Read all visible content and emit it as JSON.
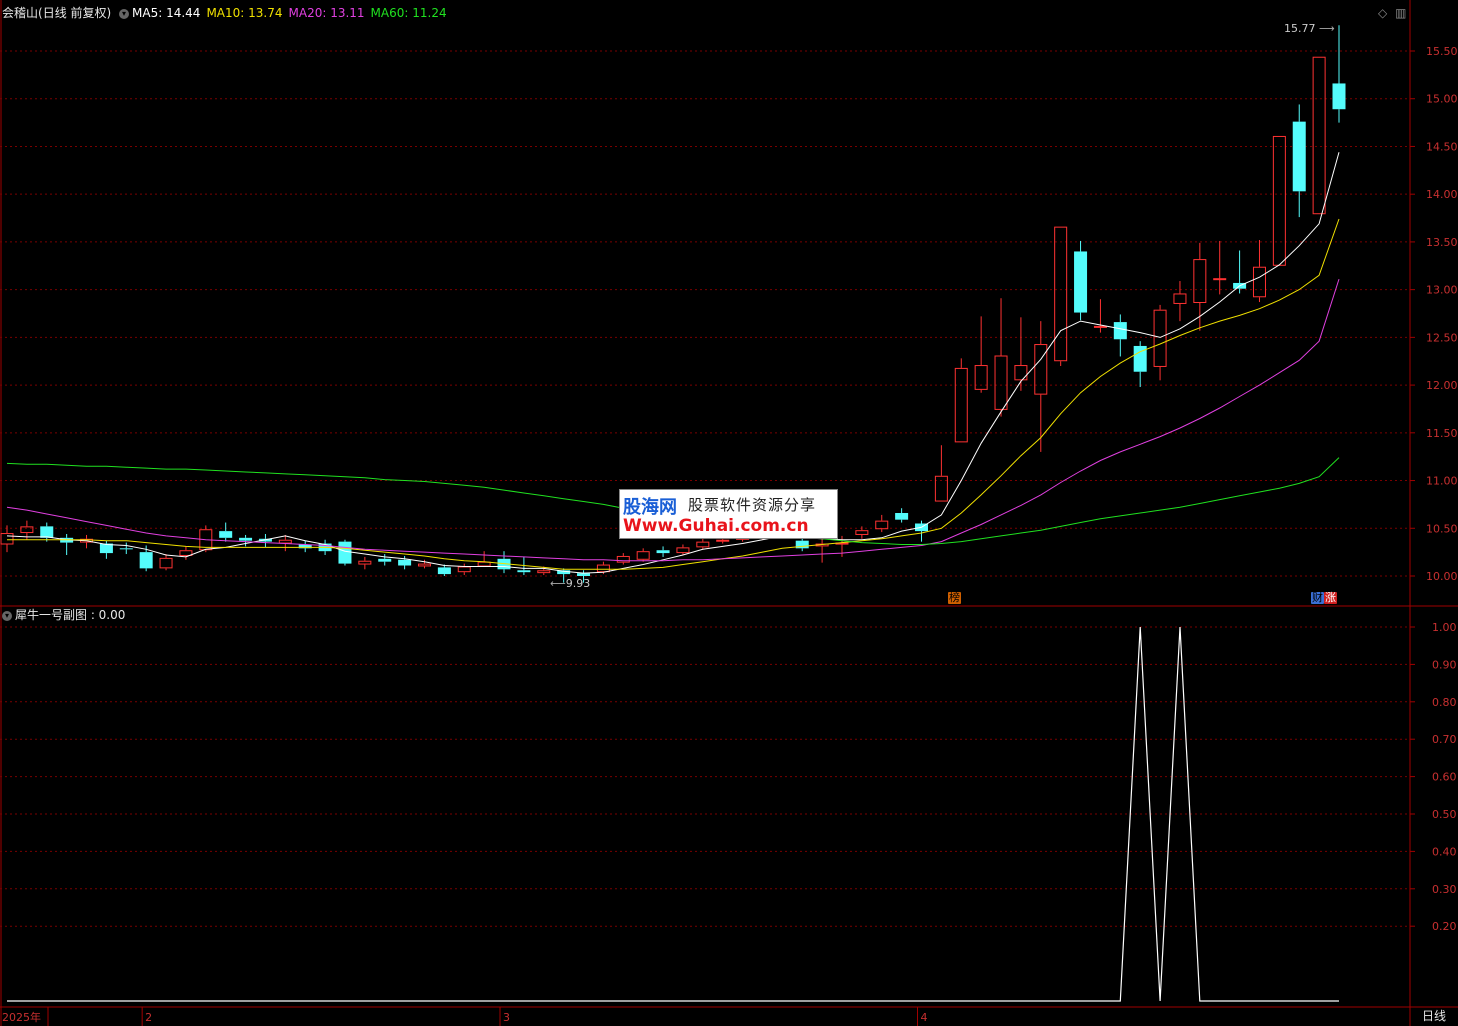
{
  "header": {
    "stock_name": "会稽山",
    "period_info": "(日线 前复权)",
    "ma_labels": [
      {
        "text": "MA5: 14.44",
        "color": "#ffffff"
      },
      {
        "text": "MA10: 13.74",
        "color": "#f0e000"
      },
      {
        "text": "MA20: 13.11",
        "color": "#e040e0"
      },
      {
        "text": "MA60: 11.24",
        "color": "#20e020"
      }
    ]
  },
  "sub_panel": {
    "title": "犀牛一号副图 : 0.00"
  },
  "annotations": {
    "high_label": "15.77",
    "low_label": "9.93",
    "tag1": "榜",
    "tag2": "财",
    "tag3": "涨"
  },
  "bottom_bar": {
    "period_button": "日线"
  },
  "watermark": {
    "logo": "股海网",
    "slogan": "股票软件资源分享",
    "url": "Www.Guhai.com.cn"
  },
  "colors": {
    "up": "#ff3232",
    "down": "#54fcfc",
    "grid": "#7a0000",
    "frame": "#a00000",
    "axis_text": "#c83030"
  },
  "chart_data": [
    {
      "type": "candlestick",
      "y_ticks": [
        10.0,
        10.5,
        11.0,
        11.5,
        12.0,
        12.5,
        13.0,
        13.5,
        14.0,
        14.5,
        15.0,
        15.5
      ],
      "ylim": [
        9.8,
        15.75
      ],
      "x_labels": [
        {
          "index": 0,
          "text": "2025年"
        },
        {
          "index": 7,
          "text": "2"
        },
        {
          "index": 25,
          "text": "3"
        },
        {
          "index": 46,
          "text": "4"
        }
      ],
      "candles": [
        [
          10.33,
          10.45,
          10.53,
          10.25
        ],
        [
          10.45,
          10.52,
          10.58,
          10.38
        ],
        [
          10.52,
          10.4,
          10.56,
          10.36
        ],
        [
          10.4,
          10.35,
          10.44,
          10.22
        ],
        [
          10.35,
          10.39,
          10.43,
          10.29
        ],
        [
          10.34,
          10.24,
          10.37,
          10.18
        ],
        [
          10.29,
          10.28,
          10.35,
          10.23
        ],
        [
          10.25,
          10.08,
          10.32,
          10.05
        ],
        [
          10.08,
          10.19,
          10.23,
          10.06
        ],
        [
          10.21,
          10.27,
          10.31,
          10.17
        ],
        [
          10.27,
          10.49,
          10.53,
          10.25
        ],
        [
          10.47,
          10.4,
          10.56,
          10.36
        ],
        [
          10.4,
          10.37,
          10.43,
          10.31
        ],
        [
          10.39,
          10.36,
          10.44,
          10.3
        ],
        [
          10.34,
          10.38,
          10.43,
          10.26
        ],
        [
          10.33,
          10.29,
          10.37,
          10.25
        ],
        [
          10.34,
          10.26,
          10.38,
          10.22
        ],
        [
          10.36,
          10.13,
          10.38,
          10.11
        ],
        [
          10.12,
          10.16,
          10.2,
          10.07
        ],
        [
          10.18,
          10.15,
          10.23,
          10.11
        ],
        [
          10.17,
          10.11,
          10.21,
          10.07
        ],
        [
          10.1,
          10.13,
          10.17,
          10.08
        ],
        [
          10.09,
          10.02,
          10.12,
          10.0
        ],
        [
          10.04,
          10.1,
          10.13,
          10.01
        ],
        [
          10.1,
          10.15,
          10.26,
          10.1
        ],
        [
          10.18,
          10.07,
          10.26,
          10.03
        ],
        [
          10.06,
          10.04,
          10.2,
          10.01
        ],
        [
          10.03,
          10.06,
          10.1,
          10.01
        ],
        [
          10.06,
          10.02,
          10.08,
          9.93
        ],
        [
          10.03,
          10.0,
          10.06,
          9.93
        ],
        [
          10.04,
          10.12,
          10.15,
          10.02
        ],
        [
          10.14,
          10.21,
          10.24,
          10.12
        ],
        [
          10.17,
          10.26,
          10.29,
          10.15
        ],
        [
          10.27,
          10.24,
          10.31,
          10.2
        ],
        [
          10.24,
          10.3,
          10.33,
          10.22
        ],
        [
          10.3,
          10.36,
          10.4,
          10.28
        ],
        [
          10.36,
          10.38,
          10.42,
          10.34
        ],
        [
          10.38,
          10.4,
          10.44,
          10.36
        ],
        [
          10.4,
          10.44,
          10.48,
          10.38
        ],
        [
          10.44,
          10.48,
          10.52,
          10.42
        ],
        [
          10.37,
          10.29,
          10.42,
          10.26
        ],
        [
          10.31,
          10.34,
          10.4,
          10.14
        ],
        [
          10.34,
          10.35,
          10.42,
          10.2
        ],
        [
          10.43,
          10.48,
          10.52,
          10.39
        ],
        [
          10.49,
          10.58,
          10.64,
          10.46
        ],
        [
          10.66,
          10.59,
          10.71,
          10.56
        ],
        [
          10.55,
          10.47,
          10.58,
          10.36
        ],
        [
          10.78,
          11.05,
          11.37,
          10.78
        ],
        [
          11.4,
          12.18,
          12.28,
          11.4
        ],
        [
          11.95,
          12.21,
          12.72,
          11.92
        ],
        [
          11.74,
          12.31,
          12.91,
          11.67
        ],
        [
          12.05,
          12.21,
          12.71,
          11.94
        ],
        [
          11.9,
          12.43,
          12.67,
          11.3
        ],
        [
          12.25,
          13.66,
          13.66,
          12.2
        ],
        [
          13.4,
          12.76,
          13.51,
          12.68
        ],
        [
          12.62,
          12.62,
          12.9,
          12.55
        ],
        [
          12.66,
          12.48,
          12.74,
          12.3
        ],
        [
          12.41,
          12.14,
          12.46,
          11.98
        ],
        [
          12.19,
          12.79,
          12.84,
          12.05
        ],
        [
          12.85,
          12.96,
          13.09,
          12.67
        ],
        [
          12.86,
          13.32,
          13.49,
          12.57
        ],
        [
          13.12,
          13.12,
          13.51,
          12.95
        ],
        [
          13.07,
          13.01,
          13.41,
          12.96
        ],
        [
          12.92,
          13.24,
          13.52,
          12.87
        ],
        [
          13.25,
          14.61,
          14.61,
          13.25
        ],
        [
          14.76,
          14.03,
          14.94,
          13.76
        ],
        [
          13.79,
          15.44,
          15.44,
          13.79
        ],
        [
          15.16,
          14.89,
          15.77,
          14.75
        ]
      ],
      "ma": {
        "MA5": [
          10.42,
          10.41,
          10.41,
          10.38,
          10.37,
          10.33,
          10.32,
          10.28,
          10.22,
          10.2,
          10.28,
          10.3,
          10.34,
          10.38,
          10.42,
          10.37,
          10.33,
          10.26,
          10.23,
          10.2,
          10.18,
          10.15,
          10.11,
          10.1,
          10.1,
          10.1,
          10.08,
          10.08,
          10.05,
          10.03,
          10.04,
          10.08,
          10.12,
          10.17,
          10.22,
          10.28,
          10.31,
          10.34,
          10.38,
          10.42,
          10.4,
          10.39,
          10.38,
          10.38,
          10.4,
          10.47,
          10.51,
          10.64,
          11.0,
          11.39,
          11.72,
          12.04,
          12.27,
          12.57,
          12.67,
          12.63,
          12.59,
          12.55,
          12.5,
          12.59,
          12.72,
          12.87,
          13.04,
          13.13,
          13.26,
          13.46,
          13.69,
          14.44
        ],
        "MA10": [
          10.38,
          10.38,
          10.38,
          10.38,
          10.38,
          10.37,
          10.37,
          10.35,
          10.33,
          10.31,
          10.3,
          10.3,
          10.3,
          10.3,
          10.3,
          10.3,
          10.3,
          10.29,
          10.27,
          10.25,
          10.23,
          10.21,
          10.18,
          10.16,
          10.15,
          10.13,
          10.11,
          10.09,
          10.07,
          10.07,
          10.07,
          10.07,
          10.08,
          10.09,
          10.12,
          10.15,
          10.18,
          10.21,
          10.25,
          10.29,
          10.31,
          10.33,
          10.35,
          10.37,
          10.39,
          10.42,
          10.45,
          10.5,
          10.66,
          10.85,
          11.05,
          11.26,
          11.45,
          11.7,
          11.92,
          12.09,
          12.23,
          12.35,
          12.43,
          12.52,
          12.6,
          12.67,
          12.73,
          12.8,
          12.89,
          13.0,
          13.15,
          13.74
        ],
        "MA20": [
          10.72,
          10.69,
          10.65,
          10.61,
          10.57,
          10.53,
          10.49,
          10.45,
          10.42,
          10.4,
          10.38,
          10.37,
          10.36,
          10.35,
          10.34,
          10.33,
          10.32,
          10.3,
          10.28,
          10.27,
          10.26,
          10.25,
          10.24,
          10.23,
          10.22,
          10.21,
          10.2,
          10.19,
          10.18,
          10.17,
          10.17,
          10.16,
          10.16,
          10.16,
          10.17,
          10.17,
          10.18,
          10.19,
          10.2,
          10.21,
          10.22,
          10.23,
          10.24,
          10.26,
          10.28,
          10.3,
          10.32,
          10.36,
          10.45,
          10.54,
          10.64,
          10.74,
          10.85,
          10.98,
          11.1,
          11.21,
          11.3,
          11.38,
          11.46,
          11.55,
          11.65,
          11.76,
          11.88,
          12.0,
          12.13,
          12.26,
          12.46,
          13.11
        ],
        "MA60": [
          11.18,
          11.17,
          11.17,
          11.16,
          11.15,
          11.15,
          11.14,
          11.13,
          11.12,
          11.12,
          11.11,
          11.1,
          11.09,
          11.08,
          11.07,
          11.06,
          11.05,
          11.04,
          11.03,
          11.01,
          11.0,
          10.99,
          10.97,
          10.95,
          10.93,
          10.9,
          10.87,
          10.84,
          10.81,
          10.78,
          10.75,
          10.71,
          10.68,
          10.64,
          10.61,
          10.57,
          10.54,
          10.5,
          10.47,
          10.44,
          10.41,
          10.39,
          10.37,
          10.35,
          10.34,
          10.33,
          10.33,
          10.34,
          10.36,
          10.39,
          10.42,
          10.45,
          10.48,
          10.52,
          10.56,
          10.6,
          10.63,
          10.66,
          10.69,
          10.72,
          10.76,
          10.8,
          10.84,
          10.88,
          10.92,
          10.97,
          11.04,
          11.24
        ]
      }
    },
    {
      "type": "line",
      "name": "犀牛一号副图",
      "y_ticks": [
        0.2,
        0.3,
        0.4,
        0.5,
        0.6,
        0.7,
        0.8,
        0.9,
        1.0
      ],
      "ylim": [
        0,
        1.0
      ],
      "values": [
        0,
        0,
        0,
        0,
        0,
        0,
        0,
        0,
        0,
        0,
        0,
        0,
        0,
        0,
        0,
        0,
        0,
        0,
        0,
        0,
        0,
        0,
        0,
        0,
        0,
        0,
        0,
        0,
        0,
        0,
        0,
        0,
        0,
        0,
        0,
        0,
        0,
        0,
        0,
        0,
        0,
        0,
        0,
        0,
        0,
        0,
        0,
        0,
        0,
        0,
        0,
        0,
        0,
        0,
        0,
        0,
        0,
        1,
        0,
        1,
        0,
        0,
        0,
        0,
        0,
        0,
        0,
        0
      ]
    }
  ]
}
